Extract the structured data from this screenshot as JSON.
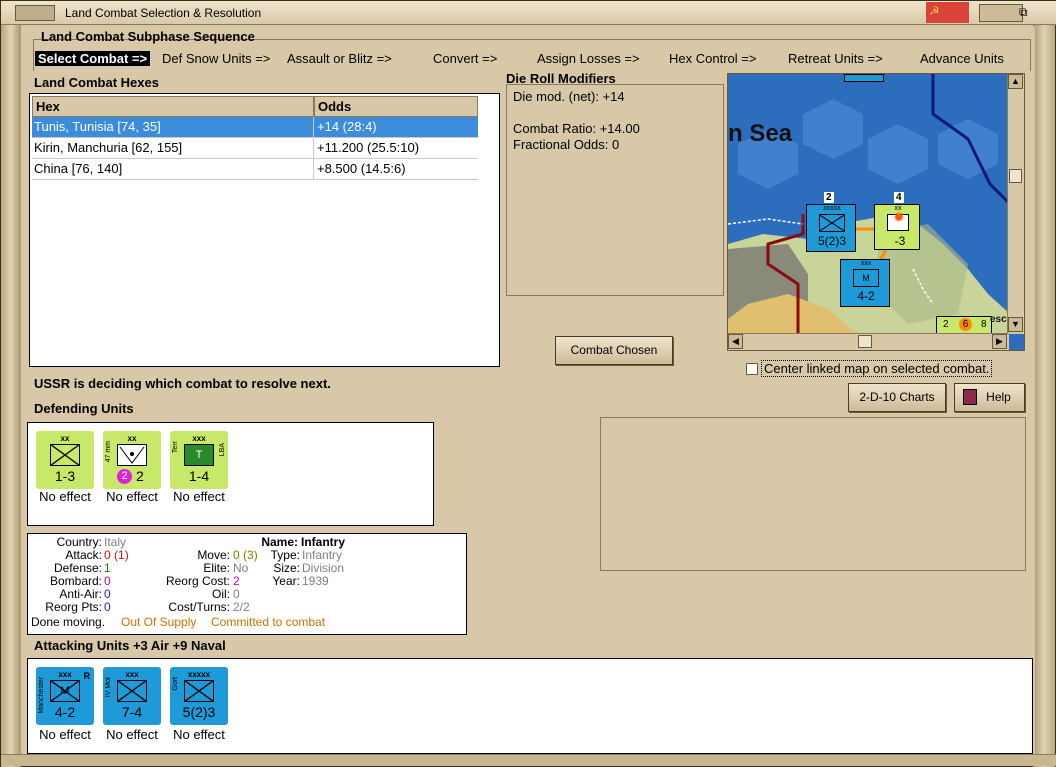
{
  "window": {
    "title": "Land Combat Selection & Resolution"
  },
  "subphase": {
    "title": "Land Combat Subphase Sequence",
    "steps": [
      "Select Combat =>",
      "Def Snow Units =>",
      "Assault or Blitz =>",
      "Convert =>",
      "Assign Losses =>",
      "Hex Control =>",
      "Retreat Units =>",
      "Advance Units"
    ]
  },
  "hexes": {
    "title": "Land Combat Hexes",
    "columns": [
      "Hex",
      "Odds"
    ],
    "rows": [
      {
        "hex": "Tunis, Tunisia [74, 35]",
        "odds": "+14 (28:4)"
      },
      {
        "hex": "Kirin, Manchuria [62, 155]",
        "odds": "+11.200 (25.5:10)"
      },
      {
        "hex": "China [76, 140]",
        "odds": "+8.500 (14.5:6)"
      }
    ]
  },
  "die_roll": {
    "title": "Die Roll Modifiers",
    "lines": [
      "Die mod. (net): +14",
      "",
      "Combat Ratio: +14.00",
      "Fractional Odds: 0"
    ]
  },
  "map": {
    "sea_label": "n Sea",
    "stack_count_1": "2",
    "stack_count_2": "4",
    "unit1_size": "xxxxx",
    "unit1_str": "5(2)3",
    "unit2_str": "-3",
    "unit2_size": "xx",
    "unit3_size": "xxx",
    "unit3_str": "4-2",
    "corner_nums": [
      "2",
      "6",
      "8"
    ],
    "corner_text": "esc",
    "colors": {
      "sea": "#2d6dbd",
      "land": "#c9d49a",
      "mountain": "#8a8a7a",
      "desert": "#e0c070"
    }
  },
  "buttons": {
    "combat_chosen": "Combat Chosen",
    "charts": "2-D-10 Charts",
    "help": "Help"
  },
  "center_map_label": "Center linked map on selected combat.",
  "status_text": "USSR is deciding which combat to resolve next.",
  "defending": {
    "title": "Defending Units",
    "units": [
      {
        "size": "xx",
        "str": "1-3",
        "effect": "No effect",
        "color": "#c8e86a"
      },
      {
        "size": "xx",
        "str": "2",
        "badge": "2",
        "vname": "47 mm",
        "effect": "No effect",
        "color": "#c8e86a"
      },
      {
        "size": "xxx",
        "str": "1-4",
        "vname": "Terr",
        "vname2": "LBA",
        "effect": "No effect",
        "color": "#c8e86a"
      }
    ]
  },
  "details": {
    "country_label": "Country:",
    "country": "Italy",
    "attack_label": "Attack:",
    "attack": "0",
    "attack_mod": "(1)",
    "defense_label": "Defense:",
    "defense": "1",
    "bombard_label": "Bombard:",
    "bombard": "0",
    "antiair_label": "Anti-Air:",
    "antiair": "0",
    "reorg_label": "Reorg Pts:",
    "reorg": "0",
    "move_label": "Move:",
    "move": "0",
    "move_mod": "(3)",
    "elite_label": "Elite:",
    "elite": "No",
    "reorg_cost_label": "Reorg Cost:",
    "reorg_cost": "2",
    "oil_label": "Oil:",
    "oil": "0",
    "cost_label": "Cost/Turns:",
    "cost": "2/2",
    "name_label": "Name:",
    "name": "Infantry",
    "type_label": "Type:",
    "type": "Infantry",
    "size_label": "Size:",
    "size": "Division",
    "year_label": "Year:",
    "year": "1939",
    "done_text": "Done moving.",
    "supply_text": "Out Of Supply",
    "committed_text": "Committed to combat"
  },
  "attacking": {
    "title": "Attacking Units +3 Air +9 Naval",
    "units": [
      {
        "size": "xxx",
        "str": "4-2",
        "vname": "Manchester",
        "rflag": "R",
        "effect": "No effect",
        "color": "#1e9ad8"
      },
      {
        "size": "xxx",
        "str": "7-4",
        "vname": "IV Mot",
        "effect": "No effect",
        "color": "#1e9ad8"
      },
      {
        "size": "xxxxx",
        "str": "5(2)3",
        "vname": "Gort",
        "effect": "No effect",
        "color": "#1e9ad8"
      }
    ]
  }
}
